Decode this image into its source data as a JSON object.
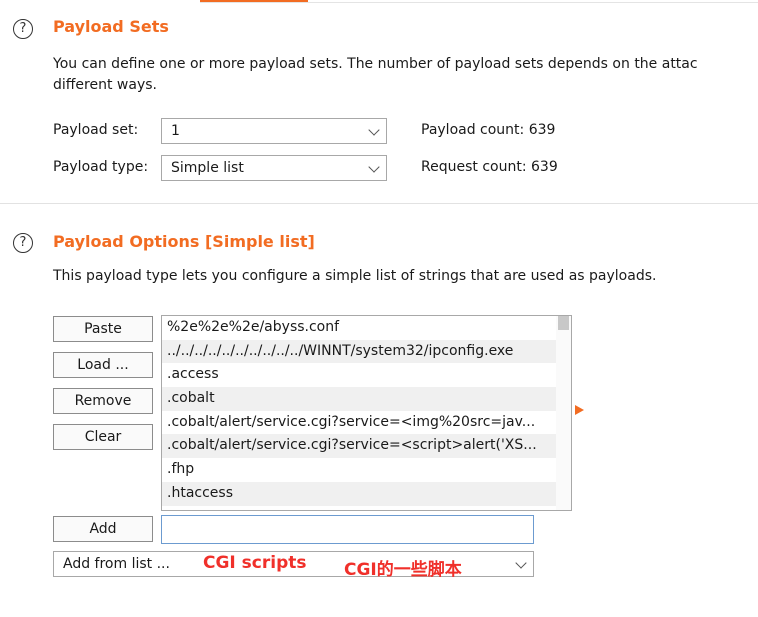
{
  "payload_sets": {
    "title": "Payload Sets",
    "description_line1": "You can define one or more payload sets. The number of payload sets depends on the attac",
    "description_line2": "different ways.",
    "payload_set_label": "Payload set:",
    "payload_set_value": "1",
    "payload_type_label": "Payload type:",
    "payload_type_value": "Simple list",
    "payload_count_label": "Payload count:",
    "payload_count": "639",
    "request_count_label": "Request count:",
    "request_count": "639"
  },
  "payload_options": {
    "title": "Payload Options [Simple list]",
    "description": "This payload type lets you configure a simple list of strings that are used as payloads.",
    "buttons": {
      "paste": "Paste",
      "load": "Load ...",
      "remove": "Remove",
      "clear": "Clear",
      "add": "Add"
    },
    "list_items": [
      "%2e%2e%2e/abyss.conf",
      "../../../../../../../../../../WINNT/system32/ipconfig.exe",
      ".access",
      ".cobalt",
      ".cobalt/alert/service.cgi?service=<img%20src=jav...",
      ".cobalt/alert/service.cgi?service=<script>alert('XS...",
      ".fhp",
      ".htaccess"
    ],
    "add_input_value": "",
    "add_from_list_label": "Add from list ...",
    "annotation_en": "CGI scripts",
    "annotation_cn": "CGI的一些脚本"
  },
  "help_glyph": "?",
  "accent_color": "#f26c22",
  "annotation_color": "#f0302a"
}
